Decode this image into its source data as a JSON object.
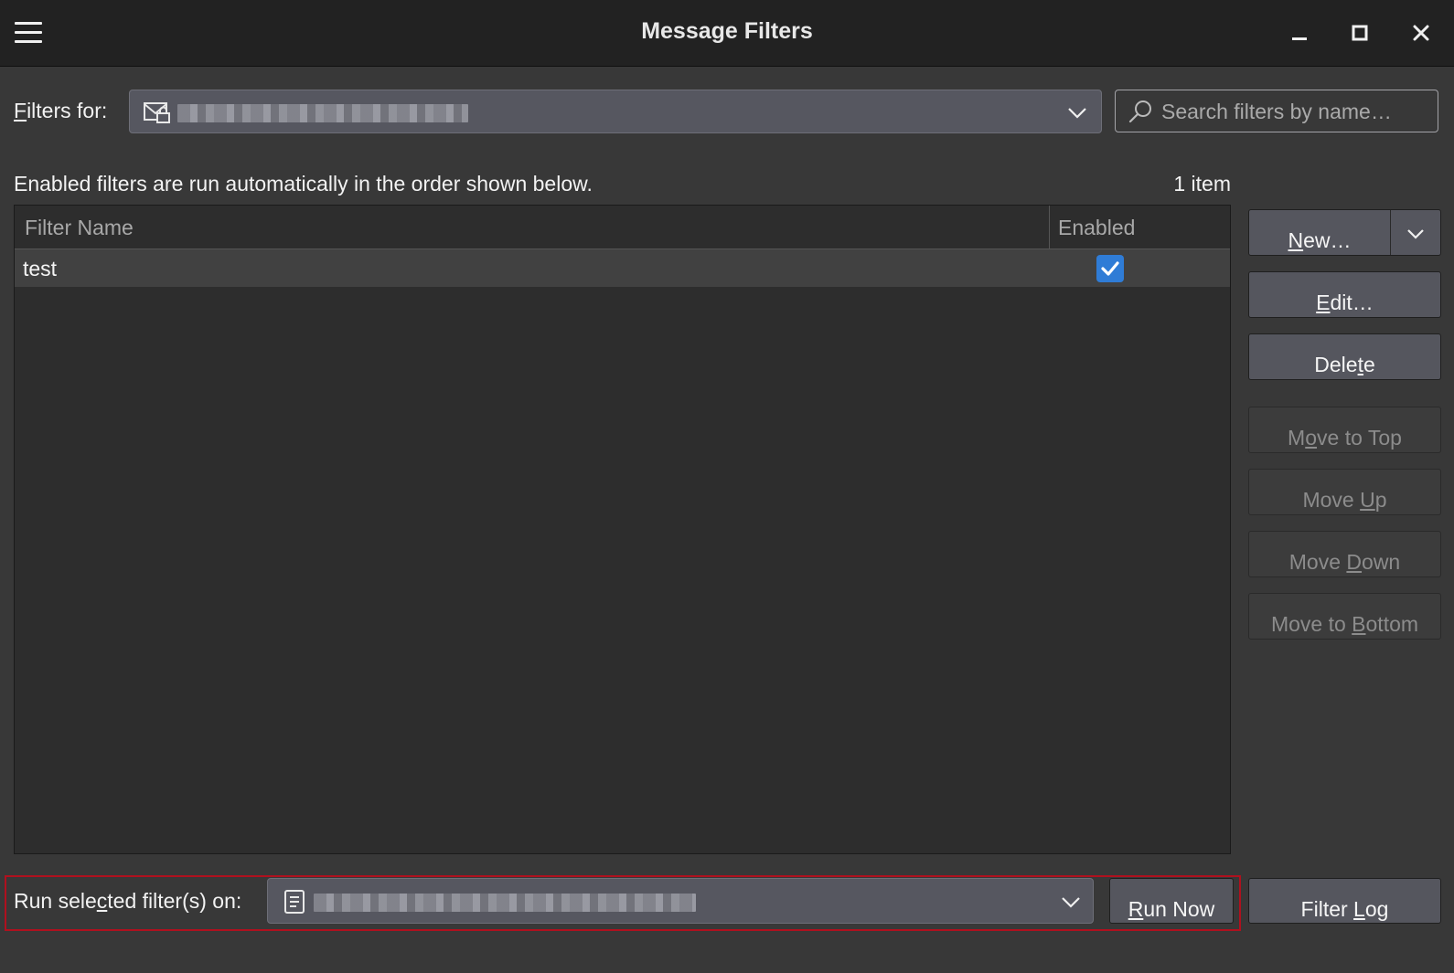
{
  "window": {
    "title": "Message Filters"
  },
  "filters_for": {
    "label_first": "F",
    "label_rest": "ilters for:",
    "account_value": "",
    "account_icon": "mail-account-lock-icon"
  },
  "search": {
    "placeholder": "Search filters by name…"
  },
  "info": {
    "description": "Enabled filters are run automatically in the order shown below.",
    "count": "1 item"
  },
  "table": {
    "columns": [
      "Filter Name",
      "Enabled"
    ],
    "rows": [
      {
        "name": "test",
        "enabled": true
      }
    ]
  },
  "buttons": {
    "new": {
      "u": "N",
      "rest": "ew…"
    },
    "edit": {
      "u": "E",
      "rest": "dit…"
    },
    "delete": {
      "pre": "Dele",
      "u": "t",
      "rest": "e"
    },
    "move_to_top": {
      "pre": "M",
      "u": "o",
      "rest": "ve to Top"
    },
    "move_up": {
      "pre": "Move ",
      "u": "U",
      "rest": "p"
    },
    "move_down": {
      "pre": "Move ",
      "u": "D",
      "rest": "own"
    },
    "move_to_bottom": {
      "pre": "Move to ",
      "u": "B",
      "rest": "ottom"
    },
    "run_now": {
      "u": "R",
      "rest": "un Now"
    },
    "filter_log": {
      "pre": "Filter ",
      "u": "L",
      "rest": "og"
    }
  },
  "run_on": {
    "label_pre": "Run sele",
    "label_u": "c",
    "label_rest": "ted filter(s) on:",
    "folder_value": "",
    "folder_icon": "folder-icon"
  },
  "colors": {
    "accent_check": "#2f7cd6",
    "highlight_border": "#b0101e"
  }
}
